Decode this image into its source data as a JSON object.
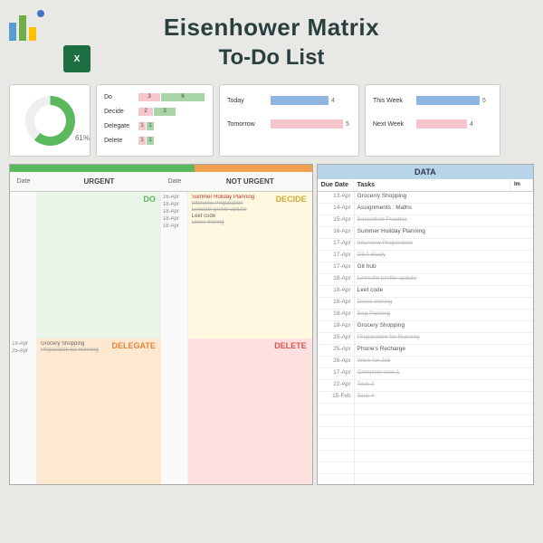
{
  "title": {
    "main": "Eisenhower Matrix",
    "sub": "To-Do List"
  },
  "excel_icon": "X",
  "donut": {
    "pct_label": "61%"
  },
  "chart_data": {
    "type": "bar",
    "priority_bars": {
      "rows": [
        {
          "label": "Do",
          "segs": [
            3,
            6
          ]
        },
        {
          "label": "Decide",
          "segs": [
            2,
            3
          ]
        },
        {
          "label": "Delegate",
          "segs": [
            1,
            1
          ]
        },
        {
          "label": "Delete",
          "segs": [
            1,
            1
          ]
        }
      ]
    },
    "today_tomorrow": {
      "rows": [
        {
          "label": "Today",
          "value": 4,
          "color": "blue"
        },
        {
          "label": "Tomorrow",
          "value": 5,
          "color": "pink"
        }
      ]
    },
    "this_next_week": {
      "rows": [
        {
          "label": "This Week",
          "value": 5,
          "color": "blue"
        },
        {
          "label": "Next Week",
          "value": 4,
          "color": "pink"
        }
      ]
    }
  },
  "matrix": {
    "header_urgent": "URGENT",
    "header_not_urgent": "NOT URGENT",
    "header_date": "Date",
    "quads": {
      "do": {
        "label": "DO",
        "dates": [],
        "tasks": []
      },
      "decide": {
        "label": "DECIDE",
        "dates": [
          "16-Apr",
          "18-Apr",
          "18-Apr",
          "18-Apr",
          "18-Apr"
        ],
        "tasks": [
          {
            "text": "Summer Holiday Planning",
            "cls": "task-red"
          },
          {
            "text": "Interview Preparation",
            "cls": "task-strike"
          },
          {
            "text": "LinkedIn profile update",
            "cls": "task-strike"
          },
          {
            "text": "Leet code",
            "cls": ""
          },
          {
            "text": "Dress Ironing",
            "cls": "task-strike"
          }
        ]
      },
      "delegate": {
        "label": "DELEGATE",
        "dates": [
          "18-Apr",
          "25-Apr"
        ],
        "tasks": [
          {
            "text": "Grocery Shopping",
            "cls": ""
          },
          {
            "text": "Preparation for Running",
            "cls": "task-strike"
          }
        ]
      },
      "delete": {
        "label": "DELETE",
        "dates": [],
        "tasks": []
      }
    }
  },
  "data": {
    "title": "DATA",
    "col_date": "Due Date",
    "col_task": "Tasks",
    "col_imp": "Im",
    "rows": [
      {
        "date": "13-Apr",
        "task": "Grocerry Shopping",
        "strike": false
      },
      {
        "date": "14-Apr",
        "task": "Assignments : Maths",
        "strike": false
      },
      {
        "date": "15-Apr",
        "task": "Basketball Practice",
        "strike": true
      },
      {
        "date": "16-Apr",
        "task": "Summer Holiday Planning",
        "strike": false
      },
      {
        "date": "17-Apr",
        "task": "Interview Preparation",
        "strike": true
      },
      {
        "date": "17-Apr",
        "task": "DSA Study",
        "strike": true
      },
      {
        "date": "17-Apr",
        "task": "Git hub",
        "strike": false
      },
      {
        "date": "18-Apr",
        "task": "LinkedIn profile update",
        "strike": true
      },
      {
        "date": "18-Apr",
        "task": "Leet code",
        "strike": false
      },
      {
        "date": "18-Apr",
        "task": "Dress Ironing",
        "strike": true
      },
      {
        "date": "18-Apr",
        "task": "Bag Packing",
        "strike": true
      },
      {
        "date": "18-Apr",
        "task": "Grocery Shopping",
        "strike": false
      },
      {
        "date": "25-Apr",
        "task": "Preparation for Running",
        "strike": true
      },
      {
        "date": "25-Apr",
        "task": "Phone's Recharge",
        "strike": false
      },
      {
        "date": "26-Apr",
        "task": "Work for Job",
        "strike": true
      },
      {
        "date": "17-Apr",
        "task": "Complete task 1",
        "strike": true
      },
      {
        "date": "22-Apr",
        "task": "Task 2",
        "strike": true
      },
      {
        "date": "15-Feb",
        "task": "Task 4",
        "strike": true
      }
    ]
  }
}
